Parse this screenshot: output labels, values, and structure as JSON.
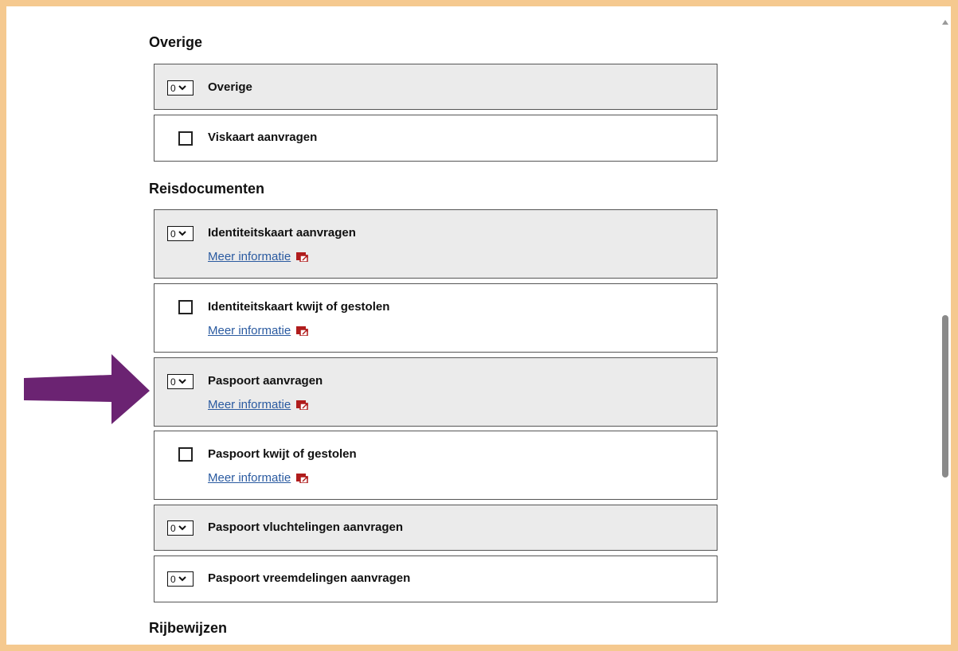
{
  "sections": [
    {
      "title": "Overige"
    },
    {
      "title": "Reisdocumenten"
    },
    {
      "title": "Rijbewijzen"
    }
  ],
  "rows": [
    {
      "label": "Overige",
      "control": "select",
      "value": "0"
    },
    {
      "label": "Viskaart aanvragen",
      "control": "checkbox"
    },
    {
      "label": "Identiteitskaart aanvragen",
      "control": "select",
      "value": "0",
      "link": "Meer informatie"
    },
    {
      "label": "Identiteitskaart kwijt of gestolen",
      "control": "checkbox",
      "link": "Meer informatie"
    },
    {
      "label": "Paspoort aanvragen",
      "control": "select",
      "value": "0",
      "link": "Meer informatie"
    },
    {
      "label": "Paspoort kwijt of gestolen",
      "control": "checkbox",
      "link": "Meer informatie"
    },
    {
      "label": "Paspoort vluchtelingen aanvragen",
      "control": "select",
      "value": "0"
    },
    {
      "label": "Paspoort vreemdelingen aanvragen",
      "control": "select",
      "value": "0"
    }
  ],
  "colors": {
    "frame": "#f5c98f",
    "row_gray": "#ebebeb",
    "link": "#2a5aa0",
    "external_icon": "#b01c1c",
    "arrow": "#6b2372"
  },
  "icons": {
    "select_chevron": "chevron-down-icon",
    "external_link": "external-link-icon",
    "annotation": "arrow-right-icon"
  }
}
